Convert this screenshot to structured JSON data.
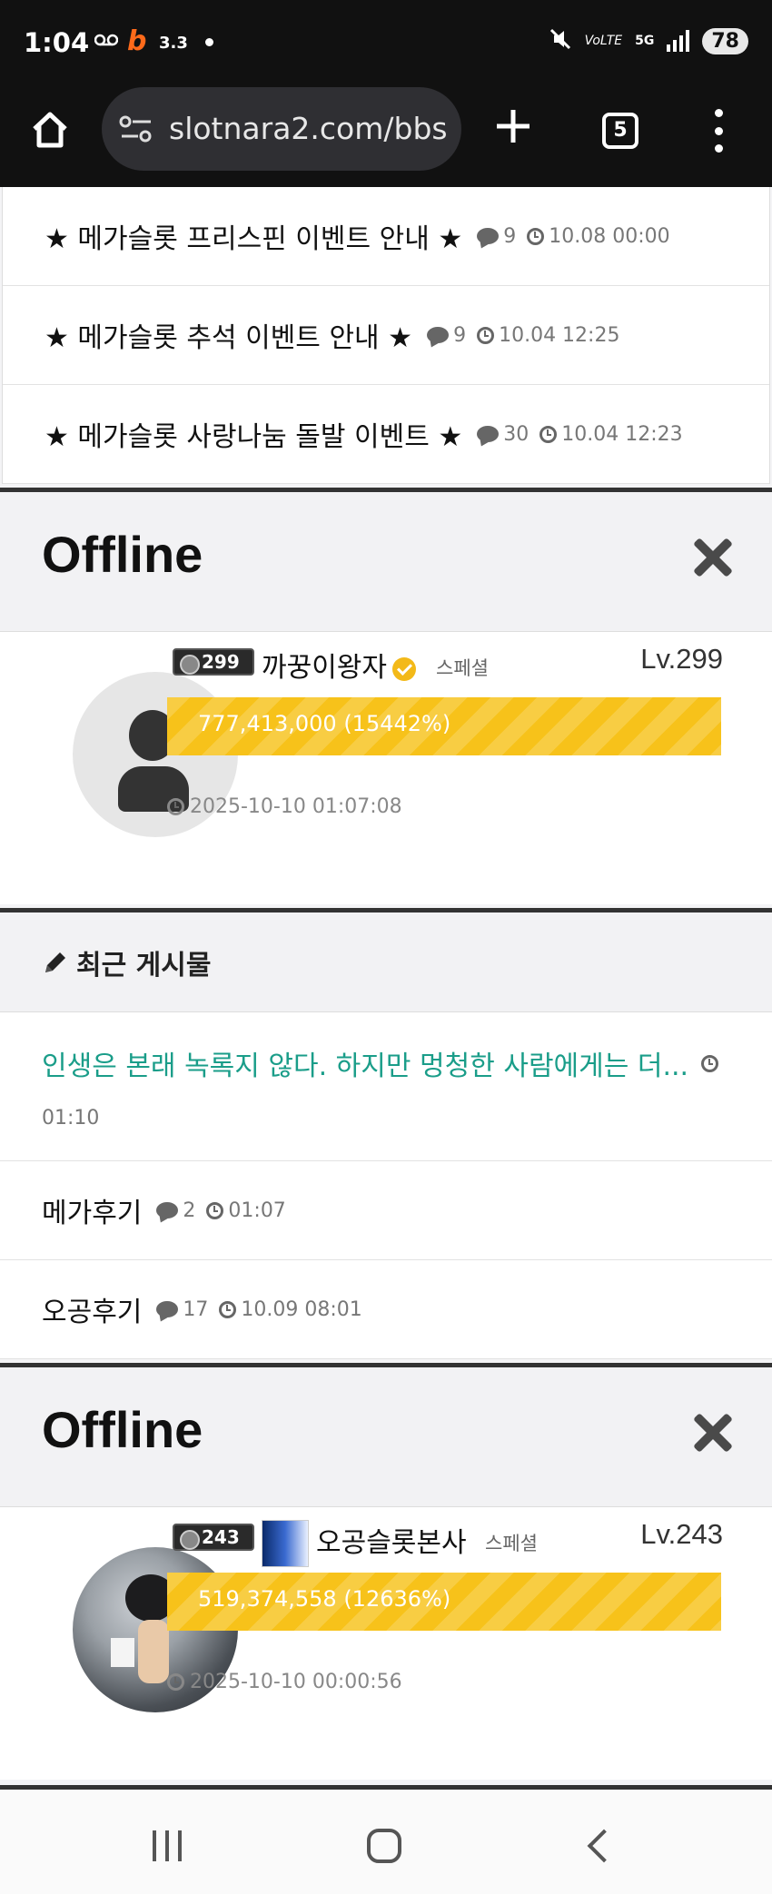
{
  "status_bar": {
    "time": "1:04",
    "speed": "3.3",
    "network_label": "5G",
    "volte_label": "VoLTE",
    "battery": "78"
  },
  "browser": {
    "url": "slotnara2.com/bbs",
    "tab_count": "5"
  },
  "notices": [
    {
      "title": "★ 메가슬롯 프리스핀 이벤트 안내 ★",
      "comments": "9",
      "time": "10.08 00:00"
    },
    {
      "title": "★ 메가슬롯 추석 이벤트 안내 ★",
      "comments": "9",
      "time": "10.04 12:25"
    },
    {
      "title": "★ 메가슬롯 사랑나눔 돌발 이벤트 ★",
      "comments": "30",
      "time": "10.04 12:23"
    }
  ],
  "profile_1": {
    "status": "Offline",
    "badge_level": "299",
    "name": "까꿍이왕자",
    "grade": "스페셜",
    "level": "Lv.299",
    "points": "777,413,000 (15442%)",
    "last_seen": "2025-10-10 01:07:08"
  },
  "recent": {
    "heading": "최근 게시물",
    "posts": [
      {
        "title": "인생은 본래 녹록지 않다. 하지만 멍청한 사람에게는 더...",
        "time": "01:10"
      },
      {
        "title": "메가후기",
        "comments": "2",
        "time": "01:07"
      },
      {
        "title": "오공후기",
        "comments": "17",
        "time": "10.09 08:01"
      }
    ]
  },
  "profile_2": {
    "status": "Offline",
    "badge_level": "243",
    "name": "오공슬롯본사",
    "grade": "스페셜",
    "level": "Lv.243",
    "points": "519,374,558 (12636%)",
    "last_seen": "2025-10-10 00:00:56"
  },
  "colors": {
    "accent_link": "#1a9d89",
    "xp_bar": "#f7c21a",
    "verify_badge": "#f3b918"
  }
}
